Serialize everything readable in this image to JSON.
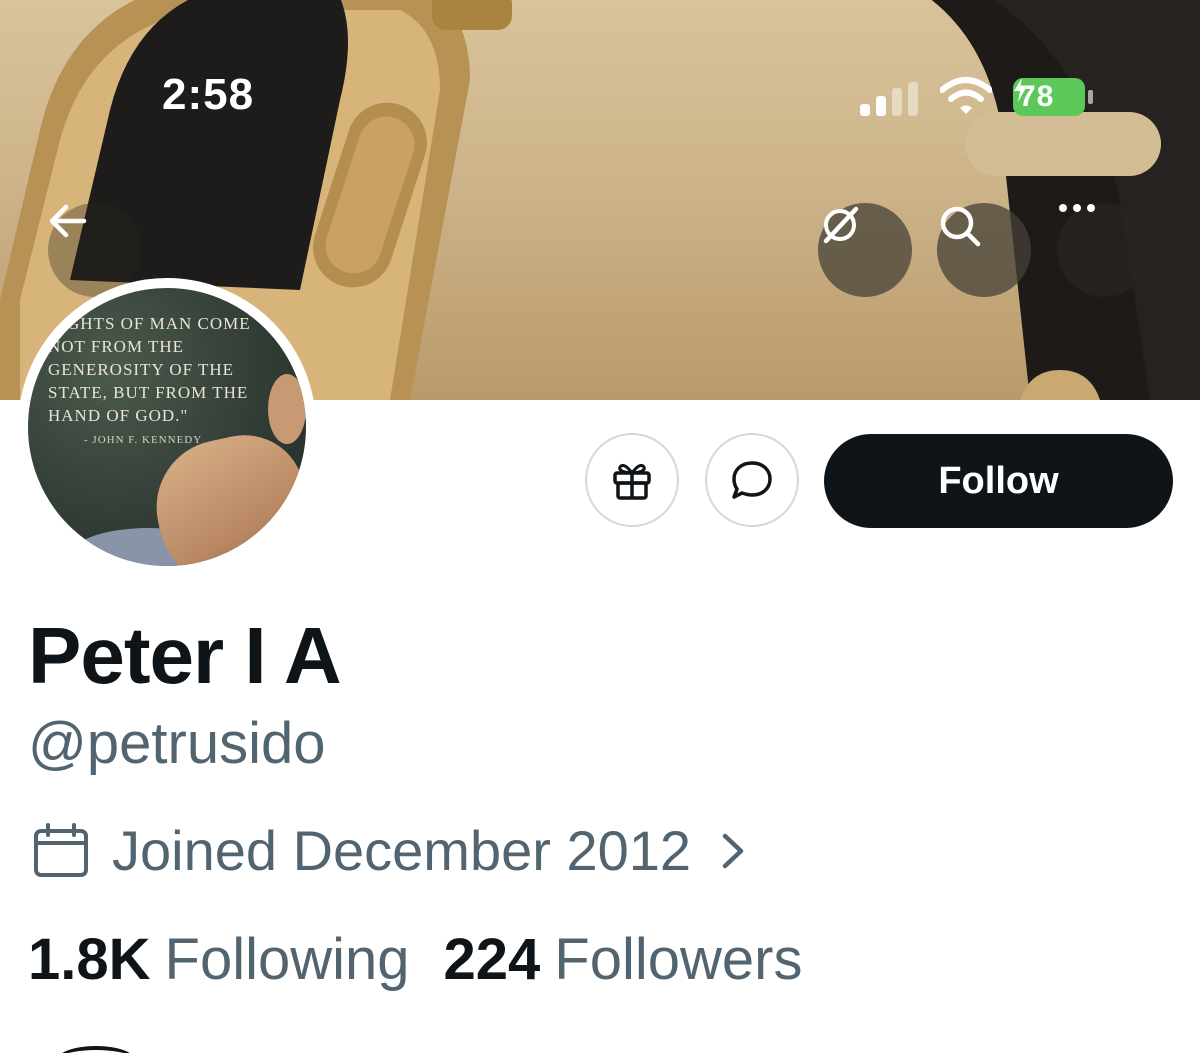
{
  "status_bar": {
    "time": "2:58",
    "battery": "78",
    "battery_color": "#5cc85a"
  },
  "header": {
    "back_icon": "arrow-left-icon",
    "grok_icon": "slash-circle-icon",
    "search_icon": "search-icon",
    "more_icon": "more-horizontal-icon"
  },
  "avatar": {
    "quote": "Rights of man come not from the generosity of the state, but from the hand of God.\"",
    "attribution": "- JOHN F. KENNEDY"
  },
  "actions": {
    "gift_icon": "gift-icon",
    "message_icon": "chat-bubble-icon",
    "follow_label": "Follow"
  },
  "profile": {
    "display_name": "Peter I A",
    "handle": "@petrusido",
    "joined": "Joined December 2012",
    "joined_icon": "calendar-icon"
  },
  "stats": {
    "following_count": "1.8K",
    "following_label": "Following",
    "followers_count": "224",
    "followers_label": "Followers"
  },
  "colors": {
    "primary_text": "#0f1419",
    "secondary_text": "#536471",
    "follow_bg": "#0f1419",
    "border": "#cfd9de"
  }
}
